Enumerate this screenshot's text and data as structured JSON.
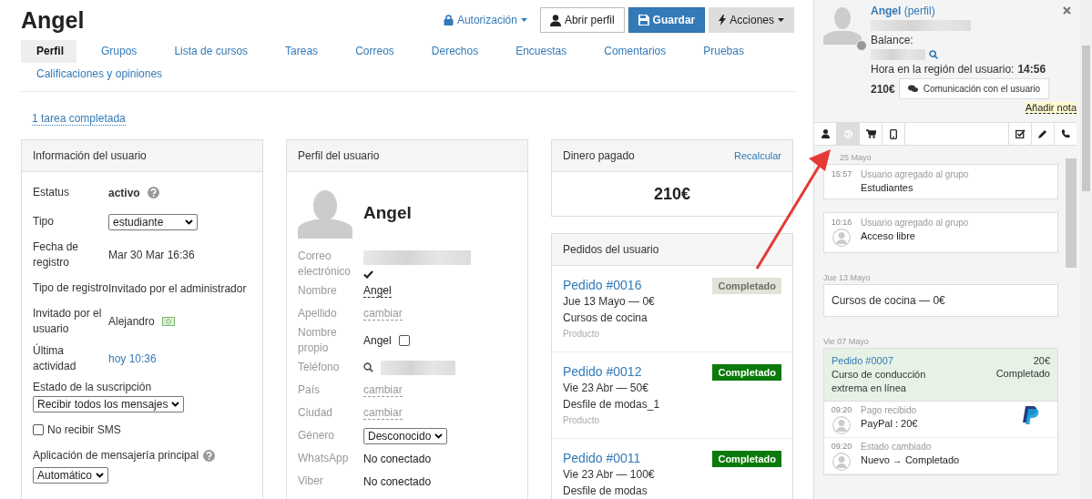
{
  "header": {
    "title": "Angel",
    "auth_menu": "Autorización",
    "buttons": [
      {
        "label": "Abrir perfil",
        "kind": "default"
      },
      {
        "label": "Guardar",
        "kind": "primary"
      },
      {
        "label": "Acciones",
        "kind": "dropdown"
      }
    ]
  },
  "tabs": [
    {
      "label": "Perfil",
      "selected": true
    },
    {
      "label": "Grupos",
      "selected": false
    },
    {
      "label": "Lista de cursos",
      "selected": false
    },
    {
      "label": "Tareas",
      "selected": false
    },
    {
      "label": "Correos",
      "selected": false
    },
    {
      "label": "Derechos",
      "selected": false
    },
    {
      "label": "Encuestas",
      "selected": false
    },
    {
      "label": "Comentarios",
      "selected": false
    },
    {
      "label": "Pruebas",
      "selected": false
    },
    {
      "label": "Calificaciones y opiniones",
      "selected": false
    }
  ],
  "task_link": "1 tarea completada",
  "user_info": {
    "title": "Información del usuario",
    "rows": [
      {
        "kind": "status",
        "label": "Estatus",
        "value": "activo"
      },
      {
        "kind": "select",
        "label": "Tipo",
        "value": "estudiante"
      },
      {
        "kind": "text",
        "label": "Fecha de registro",
        "value": "Mar 30 Mar 16:36"
      },
      {
        "kind": "text",
        "label": "Tipo de registro",
        "value": "Invitado por el administrador"
      },
      {
        "kind": "referrer",
        "label": "Invitado por el usuario",
        "value": "Alejandro"
      },
      {
        "kind": "link",
        "label": "Última actividad",
        "value": "hoy 10:36"
      }
    ],
    "subscription_label": "Estado de la suscripción",
    "subscription_value": "Recibir todos los mensajes",
    "sms": {
      "label": "No recibir SMS",
      "checked": false
    },
    "messenger_label": "Aplicación de mensajería principal",
    "messenger_value": "Automático"
  },
  "profile": {
    "title": "Perfil del usuario",
    "name": "Angel",
    "rows": [
      {
        "kind": "email",
        "label": "Correo electrónico",
        "verified": true
      },
      {
        "kind": "editable",
        "label": "Nombre",
        "value": "Angel"
      },
      {
        "kind": "change",
        "label": "Apellido",
        "value": "cambiar"
      },
      {
        "kind": "own_name",
        "label": "Nombre propio",
        "value": "Angel",
        "checked": false
      },
      {
        "kind": "phone",
        "label": "Teléfono"
      },
      {
        "kind": "change",
        "label": "País",
        "value": "cambiar"
      },
      {
        "kind": "change",
        "label": "Ciudad",
        "value": "cambiar"
      },
      {
        "kind": "select",
        "label": "Género",
        "value": "Desconocido"
      },
      {
        "kind": "text",
        "label": "WhatsApp",
        "value": "No conectado"
      },
      {
        "kind": "text",
        "label": "Viber",
        "value": "No conectado"
      }
    ]
  },
  "paid": {
    "title": "Dinero pagado",
    "action": "Recalcular",
    "amount": "210€"
  },
  "orders": {
    "title": "Pedidos del usuario",
    "items": [
      {
        "number": "Pedido #0016",
        "line": "Jue 13 Mayo — 0€",
        "product": "Cursos de cocina",
        "type": "Producto",
        "status": "Completado",
        "faded": true
      },
      {
        "number": "Pedido #0012",
        "line": "Vie 23 Abr — 50€",
        "product": "Desfile de modas_1",
        "type": "Producto",
        "status": "Completado",
        "faded": false
      },
      {
        "number": "Pedido #0011",
        "line": "Vie 23 Abr — 100€",
        "product": "Desfile de modas",
        "status": "Completado",
        "faded": false
      }
    ]
  },
  "side": {
    "name": "Angel",
    "profile_link": "(perfil)",
    "online": false,
    "balance_label": "Balance:",
    "time_label": "Hora en la región del usuario:",
    "time": "14:56",
    "amount": "210€",
    "chat_button": "Comunicación con el usuario",
    "note_link": "Añadir nota",
    "tabs": {
      "left": [
        {
          "kind": "person",
          "selected": false
        },
        {
          "kind": "history",
          "selected": true
        },
        {
          "kind": "cart",
          "selected": false
        },
        {
          "kind": "device",
          "selected": false
        }
      ],
      "right": [
        {
          "kind": "task",
          "selected": false
        },
        {
          "kind": "edit",
          "selected": false
        },
        {
          "kind": "phone",
          "selected": false
        }
      ]
    },
    "timeline": [
      {
        "date": "25 Mayo",
        "entries": [
          {
            "kind": "event",
            "time": "15:57",
            "title": "Usuario agregado al grupo",
            "detail": "Estudiantes",
            "avatar": false
          },
          {
            "kind": "event",
            "time": "10:16",
            "title": "Usuario agregado al grupo",
            "detail": "Acceso libre",
            "avatar": true
          }
        ]
      },
      {
        "date": "Jue 13 Mayo",
        "entries": [
          {
            "kind": "note",
            "text": "Cursos de cocina — 0€"
          }
        ]
      },
      {
        "date": "Vie 07 Mayo",
        "entries": [
          {
            "kind": "order",
            "number": "Pedido #0007",
            "amount": "20€",
            "product": "Curso de conducción extrema en línea",
            "status": "Completado",
            "events": [
              {
                "time": "09:20",
                "title": "Pago recibido",
                "detail": "PayPal : 20€",
                "paypal": true
              },
              {
                "time": "09:20",
                "title": "Estado cambiado",
                "detail": "Nuevo → Completado",
                "paypal": false
              }
            ]
          }
        ]
      }
    ]
  }
}
